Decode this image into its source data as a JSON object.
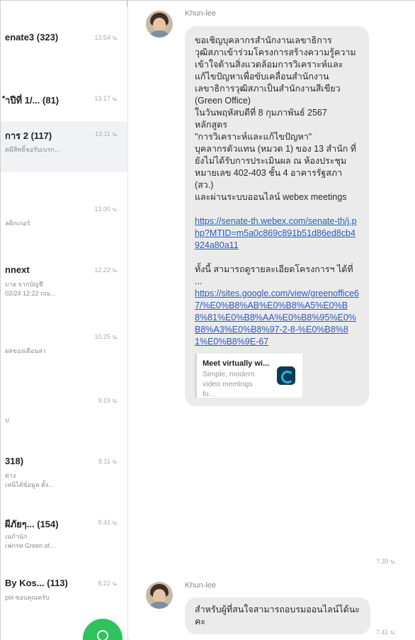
{
  "chat_list": {
    "items": [
      {
        "name": "enate3 (323)",
        "time": "13.54 น.",
        "preview": "",
        "preview2": ""
      },
      {
        "name": "ำปีที่ 1/... (81)",
        "time": "13.17 น.",
        "preview": "",
        "preview2": ""
      },
      {
        "name": "การ 2 (117)",
        "time": "13.11 น.",
        "preview": "ตมีสิทธิ์ขอรับเบรก...",
        "preview2": ""
      },
      {
        "name": "",
        "time": "13.00 น.",
        "preview": "สติกเกอร์",
        "preview2": ""
      },
      {
        "name": "nnext",
        "time": "12.22 น.",
        "preview": "บาย จากบัญชี",
        "preview2": "02/24 12:22 ถณ..."
      },
      {
        "name": "",
        "time": "10.25 น.",
        "preview": "ผลของเดือนล่า",
        "preview2": ""
      },
      {
        "name": "",
        "time": "9.19 น.",
        "preview": "ป",
        "preview2": ""
      },
      {
        "name": "318)",
        "time": "8.11 น.",
        "preview": "ต่าง",
        "preview2": "เหนิได้ข้อมูล ตั้ง..."
      },
      {
        "name": "ผีภัยๆ... (154)",
        "time": "8.41 น.",
        "preview": "เนกำนัก",
        "preview2": "เฟกรท Green of..."
      },
      {
        "name": "By Kos... (113)",
        "time": "8.22 น.",
        "preview": "pol ขอบคุณครับ",
        "preview2": ""
      }
    ]
  },
  "messages": [
    {
      "sender": "Khun-lee",
      "text": "ขอเชิญบุคลากรสำนักงานเลขาธิการวุฒิสภาเข้าร่วมโครงการสร้างความรู้ความเข้าใจด้านสิ่งแวดล้อมการวิเคราะห์และแก้ไขปัญหาเพื่อขับเคลื่อนสำนักงานเลขาธิการวุฒิสภาเป็นสำนักงานสีเขียว (Green Office)\nในวันพฤหัสบดีที่ 8 กุมภาพันธ์ 2567 หลักสูตร\n\"การวิเคราะห์และแก้ไขปัญหา\"\nบุคลากรตัวแทน (หมวด 1) ของ 13 สำนัก ที่ยังไม่ได้รับการประเมินผล ณ ห้องประชุมหมายเลข 402-403 ชั้น 4 อาคารรัฐสภา (สว.)\nและผ่านระบบออนไลน์ webex meetings",
      "link1": "https://senate-th.webex.com/senate-th/j.php?MTID=m5a0c869c891b51d86ed8cb4924a80a11",
      "text2": "ทั้งนี้ สามารถดูรายละเอียดโครงการฯ ได้ที่ ...",
      "link2": "https://sites.google.com/view/greenoffice67/%E0%B8%AB%E0%B8%A5%E0%B8%81%E0%B8%AA%E0%B8%95%E0%B8%A3%E0%B8%97-2-8-%E0%B8%81%E0%B8%9E-67",
      "card_title": "Meet virtually wi...",
      "card_desc": "Simple, modern video meetings fo...",
      "time": "7.39 น."
    },
    {
      "sender": "Khun-lee",
      "text": "สำหรับผู้ที่สนใจสามารถอบรมออนไลน์ได้นะคะ",
      "time": "7.41 น."
    }
  ]
}
